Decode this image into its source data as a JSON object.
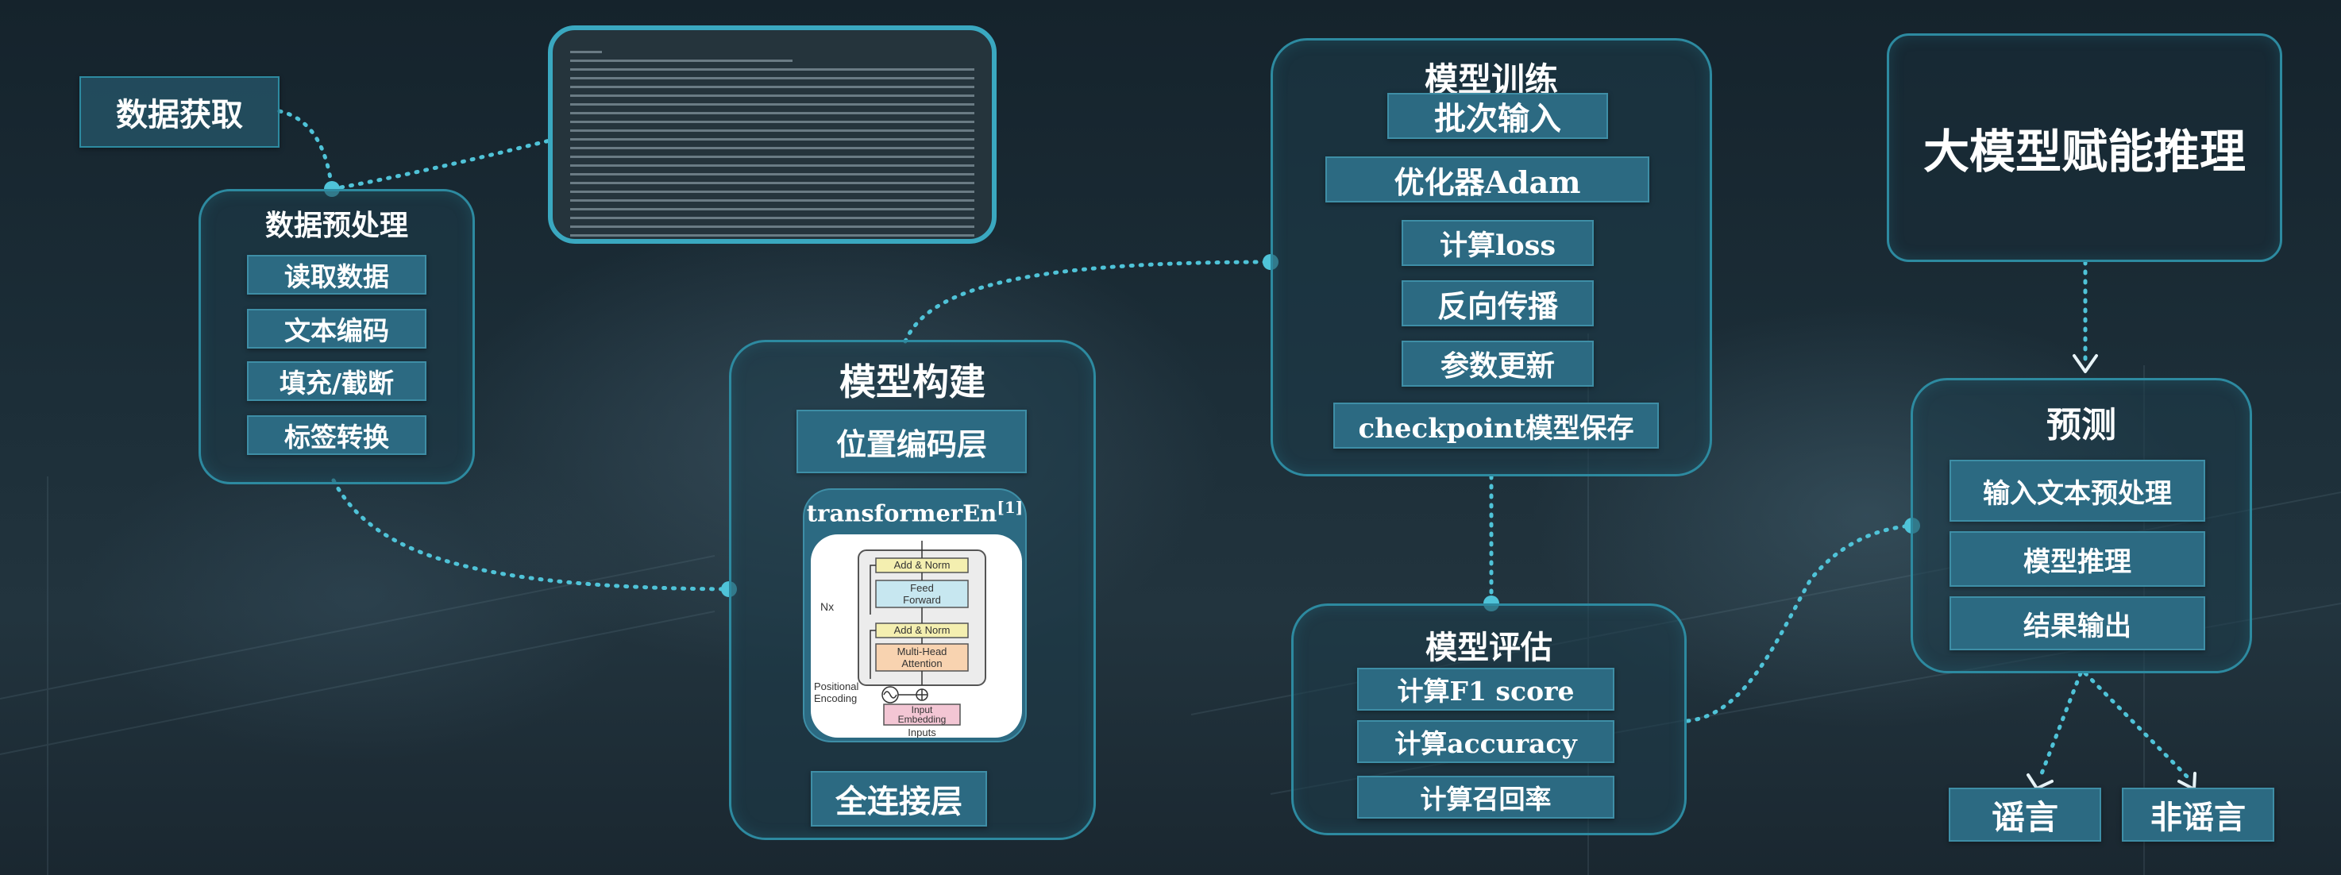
{
  "colors": {
    "accent": "#4fc3d8",
    "panel_border": "#2d8aa0",
    "button": "#2c6a82"
  },
  "data_acquisition": {
    "label": "数据获取"
  },
  "preprocessing": {
    "title": "数据预处理",
    "steps": [
      "读取数据",
      "文本编码",
      "填充/截断",
      "标签转换"
    ]
  },
  "model_build": {
    "title": "模型构建",
    "position_layer": "位置编码层",
    "transformer_label": "transformerEn",
    "transformer_ref": "[1]",
    "fc_layer": "全连接层",
    "diagram": {
      "nx": "Nx",
      "add_norm": "Add & Norm",
      "feed_forward_1": "Feed",
      "feed_forward_2": "Forward",
      "mha_1": "Multi-Head",
      "mha_2": "Attention",
      "positional_1": "Positional",
      "positional_2": "Encoding",
      "input_embedding_1": "Input",
      "input_embedding_2": "Embedding",
      "inputs": "Inputs"
    }
  },
  "training": {
    "title": "模型训练",
    "steps": [
      "批次输入",
      "优化器Adam",
      "计算loss",
      "反向传播",
      "参数更新",
      "checkpoint模型保存"
    ]
  },
  "evaluation": {
    "title": "模型评估",
    "steps": [
      "计算F1 score",
      "计算accuracy",
      "计算召回率"
    ]
  },
  "llm": {
    "label": "大模型赋能推理"
  },
  "prediction": {
    "title": "预测",
    "steps": [
      "输入文本预处理",
      "模型推理",
      "结果输出"
    ]
  },
  "outputs": {
    "rumor": "谣言",
    "non_rumor": "非谣言"
  }
}
